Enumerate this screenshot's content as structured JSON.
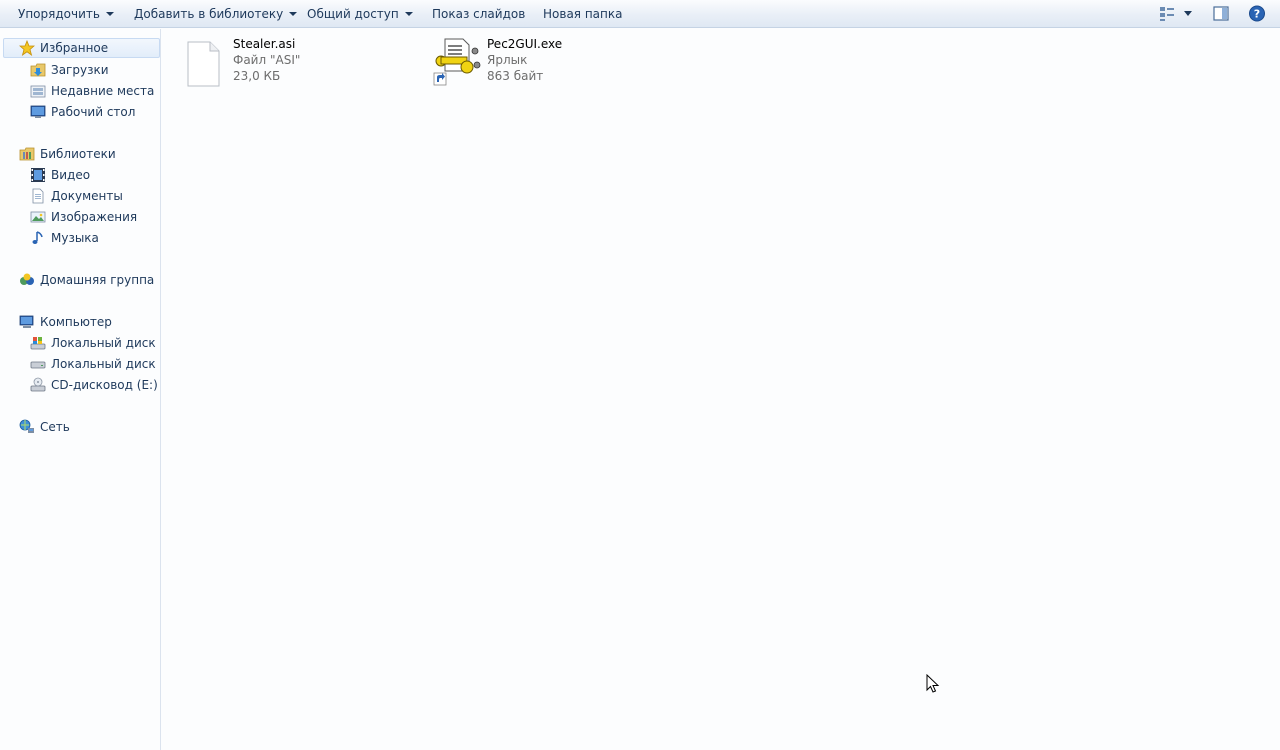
{
  "toolbar": {
    "organize": "Упорядочить",
    "add_to_library": "Добавить в библиотеку",
    "share": "Общий доступ",
    "slideshow": "Показ слайдов",
    "new_folder": "Новая папка"
  },
  "sidebar": {
    "favorites": "Избранное",
    "downloads": "Загрузки",
    "recent": "Недавние места",
    "desktop": "Рабочий стол",
    "libraries": "Библиотеки",
    "video": "Видео",
    "documents": "Документы",
    "images": "Изображения",
    "music": "Музыка",
    "homegroup": "Домашняя группа",
    "computer": "Компьютер",
    "disk_c": "Локальный диск (C:",
    "disk_d": "Локальный диск (D:",
    "cd": "CD-дисковод (E:)",
    "network": "Сеть"
  },
  "files": [
    {
      "name": "Stealer.asi",
      "type": "Файл \"ASI\"",
      "size": "23,0 КБ",
      "icon": "blank-file-icon"
    },
    {
      "name": "Pec2GUI.exe",
      "type": "Ярлык",
      "size": "863 байт",
      "icon": "shortcut-app-icon"
    }
  ],
  "colors": {
    "text": "#1e395b",
    "background": "#fcfdfe",
    "meta_text": "#6d6d6d",
    "selection": "#e2edfa"
  }
}
